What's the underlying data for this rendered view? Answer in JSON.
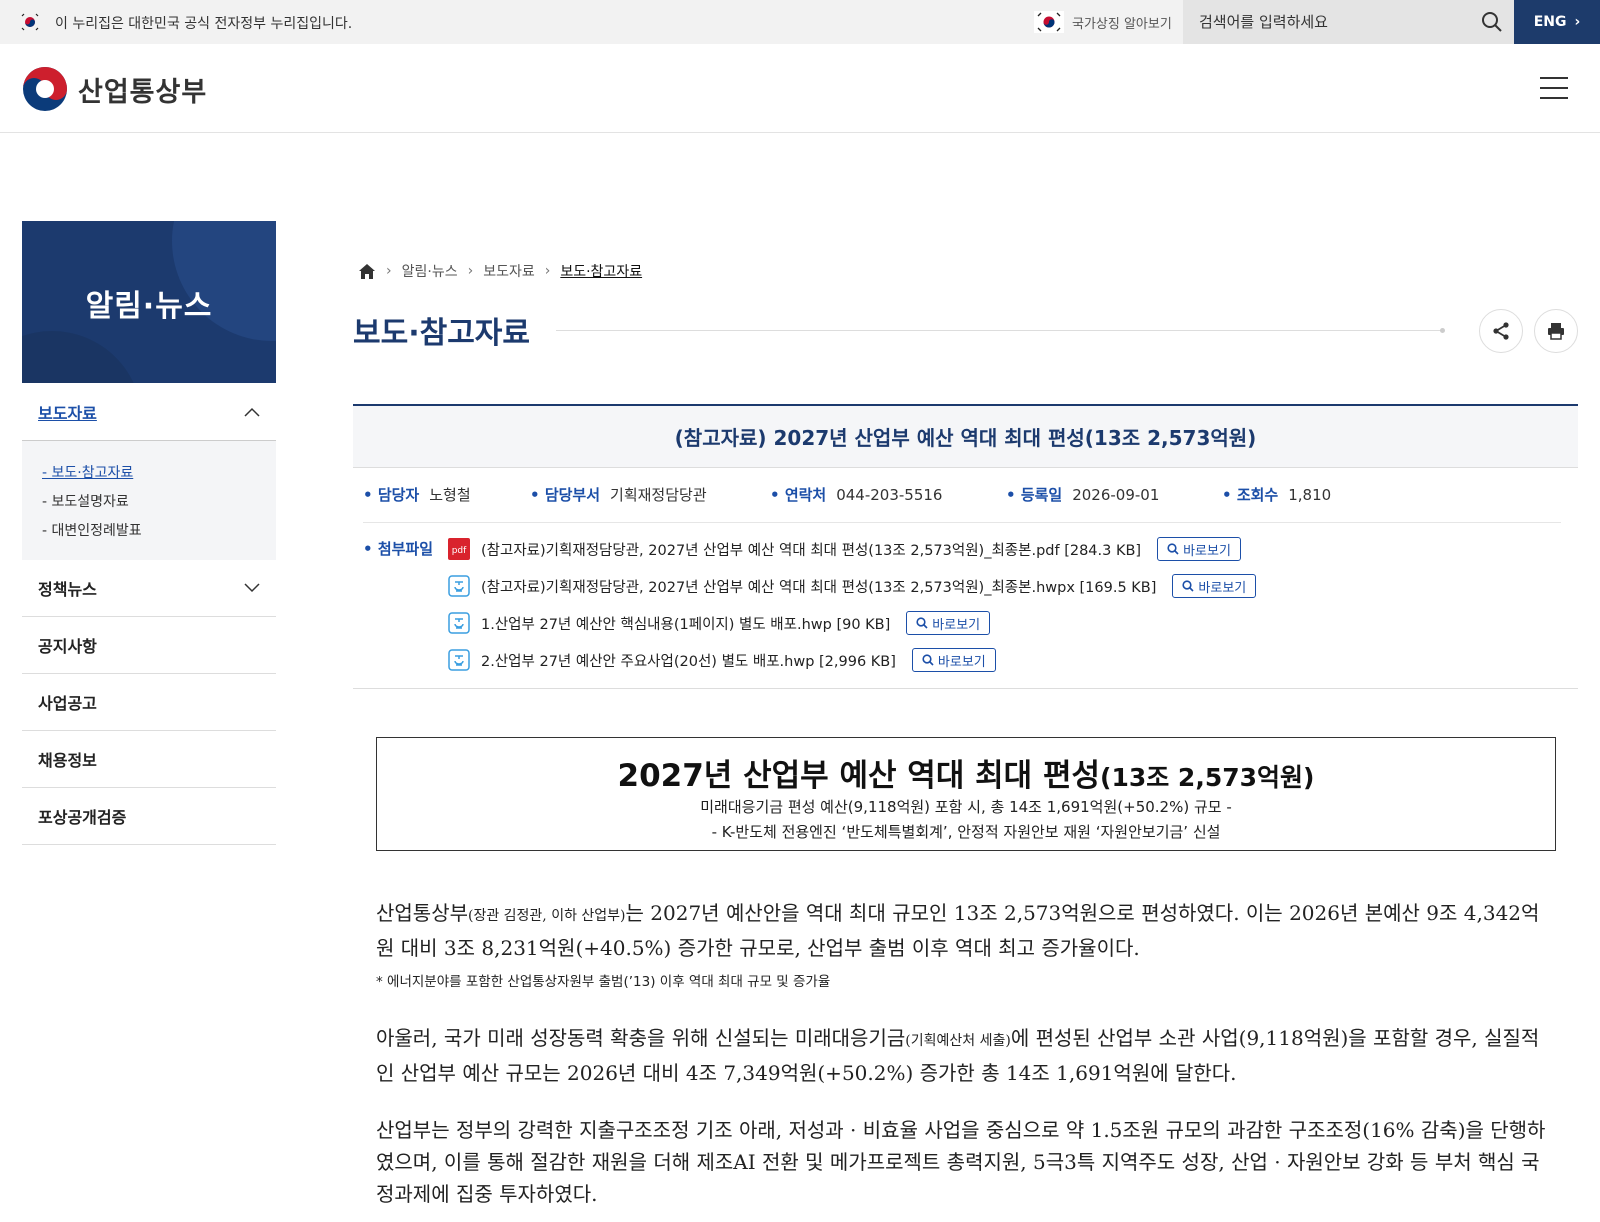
{
  "gov_banner": {
    "text": "이 누리집은 대한민국 공식 전자정부 누리집입니다."
  },
  "topbar": {
    "symbol_link": "국가상징 알아보기",
    "search_placeholder": "검색어를 입력하세요",
    "eng_label": "ENG"
  },
  "header": {
    "logo_text": "산업통상부"
  },
  "sidebar": {
    "title": "알림·뉴스",
    "menu": [
      {
        "label": "보도자료",
        "sub": [
          "보도·참고자료",
          "보도설명자료",
          "대변인정례발표"
        ]
      },
      {
        "label": "정책뉴스"
      },
      {
        "label": "공지사항"
      },
      {
        "label": "사업공고"
      },
      {
        "label": "채용정보"
      },
      {
        "label": "포상공개검증"
      }
    ]
  },
  "breadcrumb": [
    "알림·뉴스",
    "보도자료",
    "보도·참고자료"
  ],
  "page_title": "보도·참고자료",
  "article": {
    "title": "(참고자료) 2027년 산업부 예산 역대 최대 편성(13조 2,573억원)",
    "meta": [
      {
        "key": "담당자",
        "value": "노형철"
      },
      {
        "key": "담당부서",
        "value": "기획재정담당관"
      },
      {
        "key": "연락처",
        "value": "044-203-5516"
      },
      {
        "key": "등록일",
        "value": "2026-09-01"
      },
      {
        "key": "조회수",
        "value": "1,810"
      }
    ],
    "attachments_label": "첨부파일",
    "attachments": [
      {
        "name": "(참고자료)기획재정담당관, 2027년 산업부 예산 역대 최대 편성(13조 2,573억원)_최종본.pdf [284.3 KB]",
        "type": "pdf",
        "type_label": "pdf"
      },
      {
        "name": "(참고자료)기획재정담당관, 2027년 산업부 예산 역대 최대 편성(13조 2,573억원)_최종본.hwpx [169.5 KB]",
        "type": "hwp"
      },
      {
        "name": "1.산업부 27년 예산안 핵심내용(1페이지) 별도 배포.hwp [90 KB]",
        "type": "hwp"
      },
      {
        "name": "2.산업부 27년 예산안 주요사업(20선) 별도 배포.hwp [2,996 KB]",
        "type": "hwp"
      }
    ],
    "view_label": "바로보기",
    "box": {
      "headline": "2027년 산업부 예산 역대 최대 편성",
      "headline_small": "(13조 2,573억원)",
      "sub1": "미래대응기금 편성 예산(9,118억원) 포함 시, 총 14조 1,691억원(+50.2%) 규모 -",
      "sub2": "- K-반도체 전용엔진 ‘반도체특별회계’, 안정적 자원안보 재원 ‘자원안보기금’ 신설"
    },
    "p1_a": "산업통상부",
    "p1_small": "(장관 김정관, 이하 산업부)",
    "p1_b": "는 2027년 예산안을 역대 최대 규모인 13조 2,573억원으로 편성하였다. 이는 2026년 본예산 9조 4,342억원 대비 3조 8,231억원(+40.5%) 증가한 규모로, 산업부 출범 이후 역대 최고 증가율이다.",
    "note": "* 에너지분야를 포함한 산업통상자원부 출범(’13) 이후 역대 최대 규모 및 증가율",
    "p2_a": "아울러, 국가 미래 성장동력 확충을 위해 신설되는 미래대응기금",
    "p2_small": "(기획예산처 세출)",
    "p2_b": "에 편성된 산업부 소관 사업(9,118억원)을 포함할 경우, 실질적인 산업부 예산 규모는 2026년 대비 4조 7,349억원(+50.2%) 증가한 총 14조 1,691억원에 달한다.",
    "p3": "산업부는 정부의 강력한 지출구조조정 기조 아래, 저성과 · 비효율 사업을 중심으로 약 1.5조원 규모의 과감한 구조조정(16% 감축)을 단행하였으며, 이를 통해 절감한 재원을 더해 제조AI 전환 및 메가프로젝트 총력지원, 5극3특 지역주도 성장, 산업 · 자원안보 강화 등 부처 핵심 국정과제에 집중 투자하였다."
  }
}
